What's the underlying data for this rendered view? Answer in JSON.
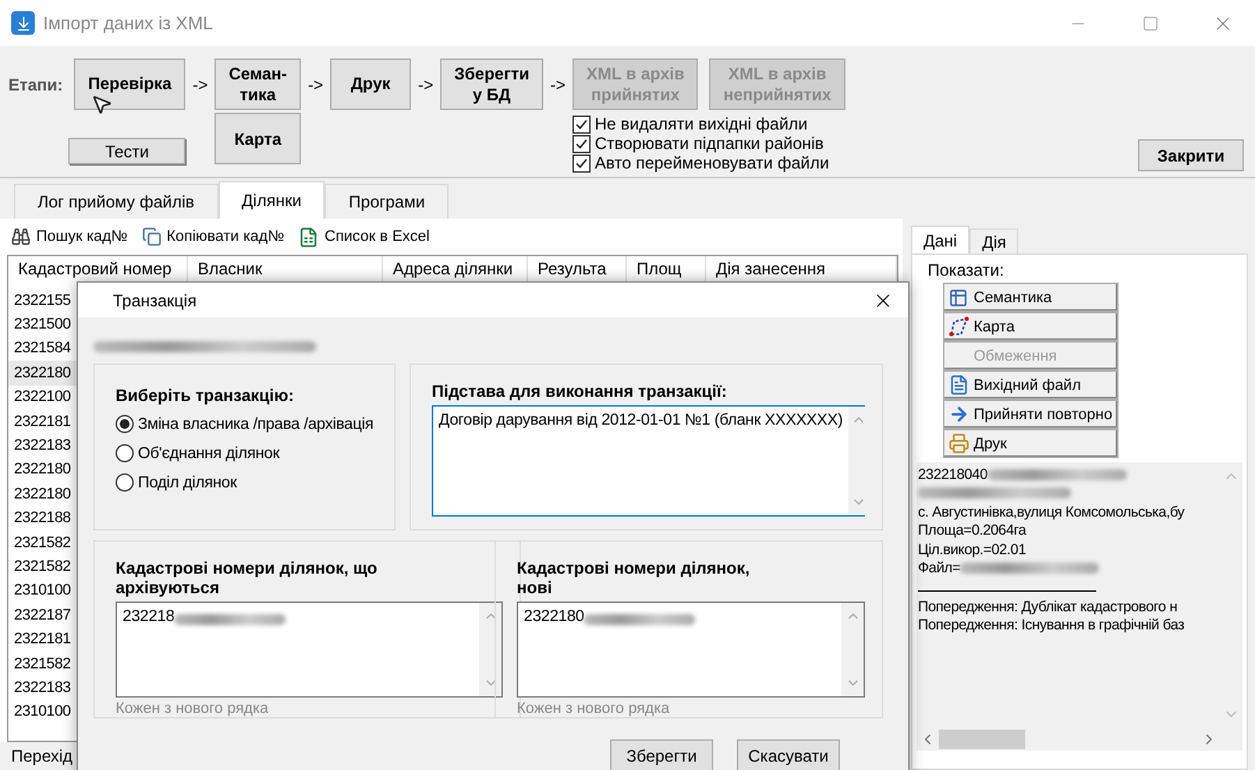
{
  "window": {
    "title": "Імпорт даних із XML"
  },
  "stages": {
    "label": "Етапи:",
    "items": [
      {
        "kind": "button",
        "label": "Перевірка",
        "disabled": false,
        "below": {
          "kind": "small",
          "label": "Тести"
        }
      },
      {
        "kind": "arrow",
        "label": "->"
      },
      {
        "kind": "button",
        "label": "Семан-\nтика",
        "disabled": false,
        "below": {
          "kind": "tall",
          "label": "Карта"
        }
      },
      {
        "kind": "arrow",
        "label": "->"
      },
      {
        "kind": "button",
        "label": "Друк",
        "disabled": false
      },
      {
        "kind": "arrow",
        "label": "->"
      },
      {
        "kind": "button",
        "label": "Зберегти\nу БД",
        "disabled": false
      },
      {
        "kind": "arrow",
        "label": "->"
      },
      {
        "kind": "button",
        "label": "XML в архів\nприйнятих",
        "disabled": true
      },
      {
        "kind": "button",
        "label": "XML в архів\nнеприйнятих",
        "disabled": true
      }
    ]
  },
  "options": [
    {
      "label": "Не видаляти вихідні файли",
      "checked": true
    },
    {
      "label": "Створювати підпапки районів",
      "checked": true
    },
    {
      "label": "Авто перейменовувати файли",
      "checked": true
    }
  ],
  "close_button": {
    "label": "Закрити"
  },
  "tabs": [
    {
      "label": "Лог прийому файлів",
      "selected": false
    },
    {
      "label": "Ділянки",
      "selected": true
    },
    {
      "label": "Програми",
      "selected": false
    }
  ],
  "toolbar": [
    {
      "kind": "search",
      "label": "Пошук кад№"
    },
    {
      "kind": "copy",
      "label": "Копіювати кад№"
    },
    {
      "kind": "excel",
      "label": "Список в Excel"
    }
  ],
  "table": {
    "columns": [
      "Кадастровий номер",
      "Власник",
      "Адреса ділянки",
      "Результа",
      "Площ",
      "Дія занесення"
    ],
    "rows": [
      {
        "cadastral": "2322155",
        "selected": false
      },
      {
        "cadastral": "2321500",
        "selected": false
      },
      {
        "cadastral": "2321584",
        "selected": false
      },
      {
        "cadastral": "2322180",
        "selected": true
      },
      {
        "cadastral": "2322100",
        "selected": false
      },
      {
        "cadastral": "2322181",
        "selected": false
      },
      {
        "cadastral": "2322183",
        "selected": false
      },
      {
        "cadastral": "2322180",
        "selected": false
      },
      {
        "cadastral": "2322180",
        "selected": false
      },
      {
        "cadastral": "2322188",
        "selected": false
      },
      {
        "cadastral": "2321582",
        "selected": false
      },
      {
        "cadastral": "2321582",
        "selected": false
      },
      {
        "cadastral": "2310100",
        "selected": false
      },
      {
        "cadastral": "2322187",
        "selected": false
      },
      {
        "cadastral": "2322181",
        "selected": false
      },
      {
        "cadastral": "2321582",
        "selected": false
      },
      {
        "cadastral": "2322183",
        "selected": false
      },
      {
        "cadastral": "2310100",
        "selected": false
      }
    ]
  },
  "status_bar": {
    "text": "Перехід"
  },
  "side_panel": {
    "tabs": [
      {
        "label": "Дані",
        "selected": true
      },
      {
        "label": "Дія",
        "selected": false
      }
    ],
    "show_label": "Показати:",
    "actions": [
      {
        "kind": "semantics",
        "label": "Семантика",
        "disabled": false
      },
      {
        "kind": "map",
        "label": "Карта",
        "disabled": false
      },
      {
        "kind": "none",
        "label": "Обмеження",
        "disabled": true
      },
      {
        "kind": "file",
        "label": "Вихідний файл",
        "disabled": false
      },
      {
        "kind": "resend",
        "label": "Прийняти повторно",
        "disabled": false
      },
      {
        "kind": "print",
        "label": "Друк",
        "disabled": false
      }
    ],
    "lines": [
      {
        "kind": "text",
        "text": "232218040",
        "blurred": true
      },
      {
        "kind": "text",
        "blurred": true
      },
      {
        "kind": "text",
        "text": "с. Августинівка,вулиця Комсомольська,бу",
        "blurred": false
      },
      {
        "kind": "text",
        "text": "Площа=0.2064га",
        "blurred": false
      },
      {
        "kind": "text",
        "text": "Ціл.викор.=02.01",
        "blurred": false
      },
      {
        "kind": "text",
        "text": "Файл=",
        "blurred": true
      },
      {
        "kind": "rule"
      },
      {
        "kind": "text",
        "text": "Попередження: Дублікат кадастрового н",
        "blurred": false
      },
      {
        "kind": "text",
        "text": "Попередження: Існування в графічній баз",
        "blurred": false
      }
    ]
  },
  "dialog": {
    "title": "Транзакція",
    "owner_blurred": true,
    "transaction": {
      "title": "Виберіть транзакцію:",
      "options": [
        {
          "label": "Зміна власника /права /архівація",
          "selected": true
        },
        {
          "label": "Об'єднання ділянок",
          "selected": false
        },
        {
          "label": "Поділ ділянок",
          "selected": false
        }
      ]
    },
    "basis": {
      "title": "Підстава для виконання транзакції:",
      "value": "Договір дарування від 2012-01-01 №1 (бланк XXXXXXX)"
    },
    "lists": [
      {
        "title": "Кадастрові номери ділянок, що\nархівуються",
        "value": "232218",
        "blurred": true,
        "hint": "Кожен з нового рядка"
      },
      {
        "title": "Кадастрові номери ділянок,\nнові",
        "value": "2322180",
        "blurred": true,
        "hint": "Кожен з нового рядка"
      }
    ],
    "buttons": [
      "Зберегти",
      "Скасувати"
    ]
  }
}
